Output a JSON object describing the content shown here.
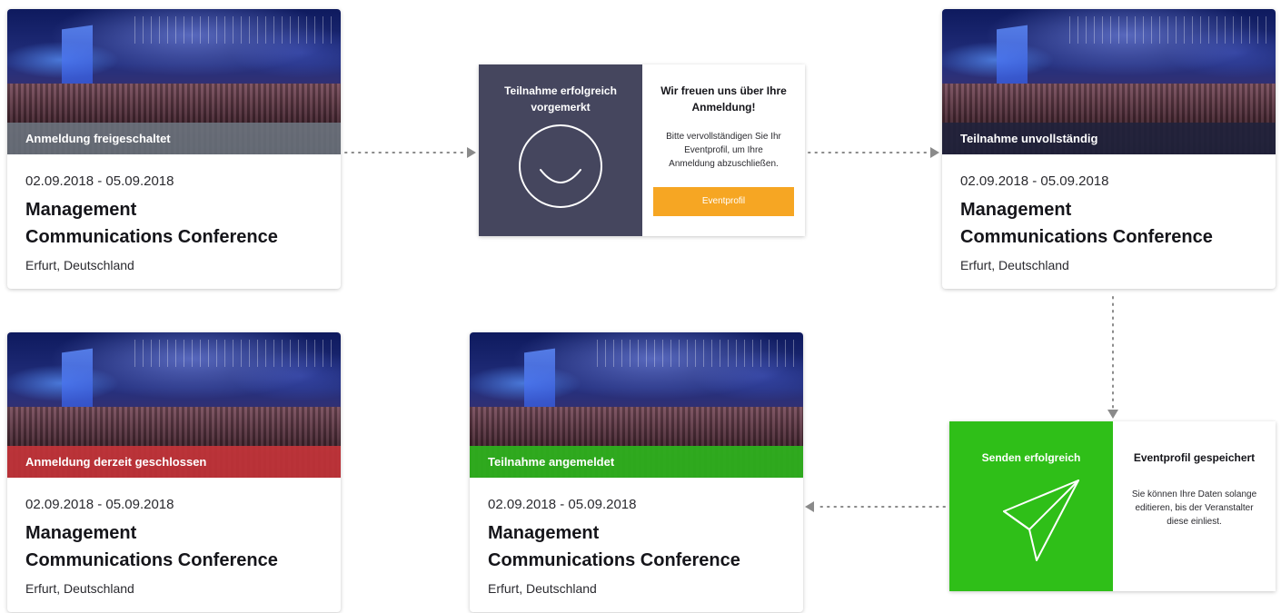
{
  "cards": [
    {
      "status": "Anmeldung freigeschaltet",
      "date": "02.09.2018 - 05.09.2018",
      "title_line1": "Management",
      "title_line2": "Communications Conference",
      "location": "Erfurt, Deutschland"
    },
    {
      "status": "Teilnahme unvollständig",
      "date": "02.09.2018 - 05.09.2018",
      "title_line1": "Management",
      "title_line2": "Communications Conference",
      "location": "Erfurt, Deutschland"
    },
    {
      "status": "Anmeldung derzeit geschlossen",
      "date": "02.09.2018 - 05.09.2018",
      "title_line1": "Management",
      "title_line2": "Communications Conference",
      "location": "Erfurt, Deutschland"
    },
    {
      "status": "Teilnahme angemeldet",
      "date": "02.09.2018 - 05.09.2018",
      "title_line1": "Management",
      "title_line2": "Communications Conference",
      "location": "Erfurt, Deutschland"
    }
  ],
  "modal_registration": {
    "left_title": "Teilnahme erfolgreich vorgemerkt",
    "right_title": "Wir freuen uns über Ihre Anmeldung!",
    "right_text": "Bitte vervollständigen Sie Ihr Eventprofil, um Ihre Anmeldung abzuschließen.",
    "button_label": "Eventprofil",
    "icon": "smiley-icon",
    "accent": "#45465e",
    "button_color": "#f6a623"
  },
  "modal_saved": {
    "left_title": "Senden erfolgreich",
    "right_title": "Eventprofil gespeichert",
    "right_text": "Sie können Ihre Daten solange editieren, bis der Veranstalter diese einliest.",
    "icon": "paper-plane-icon",
    "accent": "#2fbf18"
  },
  "colors": {
    "status_grey": "#6e7882",
    "status_dark": "#20223c",
    "status_red": "#c4343a",
    "status_green": "#2eb01e",
    "connector": "#8a8a8a"
  }
}
